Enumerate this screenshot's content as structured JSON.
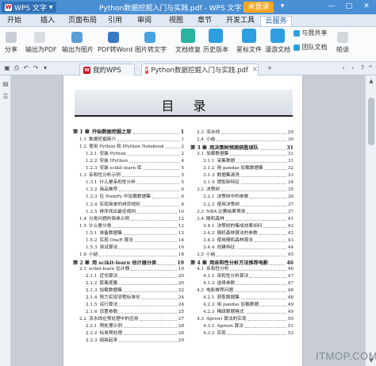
{
  "titlebar": {
    "app_name": "WPS 文字",
    "document_title": "Python数据挖掘入门与实践.pdf - WPS 文字",
    "login": "未登录",
    "minimize": "—",
    "maximize": "□",
    "close": "✕",
    "accent": "#4a8fd3"
  },
  "menu": {
    "items": [
      "开始",
      "插入",
      "页面布局",
      "引用",
      "审阅",
      "视图",
      "章节",
      "开发工具",
      "云服务"
    ],
    "active": "云服务"
  },
  "ribbon": {
    "buttons": [
      {
        "label": "分享",
        "icon": "share-icon"
      },
      {
        "label": "输出为PDF",
        "icon": "pdf-icon"
      },
      {
        "label": "输出为图片",
        "icon": "image-icon"
      },
      {
        "label": "PDF转Word",
        "icon": "pdf-word-icon"
      },
      {
        "label": "图片转文字",
        "icon": "ocr-icon"
      },
      {
        "label": "文档修复",
        "icon": "repair-icon"
      },
      {
        "label": "历史版本",
        "icon": "history-icon"
      },
      {
        "label": "星标文件",
        "icon": "star-file-icon"
      },
      {
        "label": "漫游文档",
        "icon": "roam-doc-icon"
      },
      {
        "label": "与我共享",
        "icon": "share-with-me-icon"
      },
      {
        "label": "团队文档",
        "icon": "team-doc-icon"
      },
      {
        "label": "帕谈",
        "icon": "chat-icon"
      }
    ]
  },
  "tabs": [
    {
      "label": "我的WPS",
      "active": false
    },
    {
      "label": "Python数据挖掘入门与实践.pdf",
      "active": true
    }
  ],
  "page": {
    "heading": "目录",
    "left_column": [
      {
        "num": "第 1 章",
        "text": "开始数据挖掘之旅",
        "page": "1",
        "level": 0
      },
      {
        "num": "1.1",
        "text": "数据挖掘简介",
        "page": "1",
        "level": 1
      },
      {
        "num": "1.2",
        "text": "使用 Python 和 IPython Notebook",
        "page": "2",
        "level": 1
      },
      {
        "num": "1.2.1",
        "text": "安装 Python",
        "page": "2",
        "level": 2
      },
      {
        "num": "1.2.2",
        "text": "安装 IPython",
        "page": "4",
        "level": 2
      },
      {
        "num": "1.2.3",
        "text": "安装 scikit-learn 库",
        "page": "5",
        "level": 2
      },
      {
        "num": "1.3",
        "text": "亲和性分析示例",
        "page": "5",
        "level": 1
      },
      {
        "num": "1.3.1",
        "text": "什么是亲和性分析",
        "page": "5",
        "level": 2
      },
      {
        "num": "1.3.2",
        "text": "商品推荐",
        "page": "6",
        "level": 2
      },
      {
        "num": "1.3.3",
        "text": "在 NumPy 中加载数据集",
        "page": "6",
        "level": 2
      },
      {
        "num": "1.3.4",
        "text": "实现简单的排序规则",
        "page": "8",
        "level": 2
      },
      {
        "num": "1.3.5",
        "text": "排序找出最佳规则",
        "page": "10",
        "level": 2
      },
      {
        "num": "1.4",
        "text": "分类问题的简单示例",
        "page": "12",
        "level": 1
      },
      {
        "num": "1.5",
        "text": "什么是分类",
        "page": "12",
        "level": 1
      },
      {
        "num": "1.5.1",
        "text": "准备数据集",
        "page": "13",
        "level": 2
      },
      {
        "num": "1.5.2",
        "text": "实现 OneR 算法",
        "page": "14",
        "level": 2
      },
      {
        "num": "1.5.3",
        "text": "测试算法",
        "page": "16",
        "level": 2
      },
      {
        "num": "1.6",
        "text": "小结",
        "page": "18",
        "level": 1
      },
      {
        "num": "第 2 章",
        "text": "用 scikit-learn 估计器分类",
        "page": "19",
        "level": 0
      },
      {
        "num": "2.1",
        "text": "scikit-learn 估计器",
        "page": "19",
        "level": 1
      },
      {
        "num": "2.1.1",
        "text": "近邻算法",
        "page": "20",
        "level": 2
      },
      {
        "num": "2.1.2",
        "text": "距离度量",
        "page": "20",
        "level": 2
      },
      {
        "num": "2.1.3",
        "text": "加载数据集",
        "page": "22",
        "level": 2
      },
      {
        "num": "2.1.4",
        "text": "努力实现流程标准化",
        "page": "24",
        "level": 2
      },
      {
        "num": "2.1.5",
        "text": "运行算法",
        "page": "24",
        "level": 2
      },
      {
        "num": "2.1.6",
        "text": "设置参数",
        "page": "25",
        "level": 2
      },
      {
        "num": "2.2",
        "text": "流水线在预处理中的应用",
        "page": "27",
        "level": 1
      },
      {
        "num": "2.2.1",
        "text": "预处理示例",
        "page": "28",
        "level": 2
      },
      {
        "num": "2.2.2",
        "text": "标准预处理",
        "page": "28",
        "level": 2
      },
      {
        "num": "2.2.3",
        "text": "组装起来",
        "page": "29",
        "level": 2
      }
    ],
    "right_column": [
      {
        "num": "2.3",
        "text": "流水线",
        "page": "29",
        "level": 1
      },
      {
        "num": "2.4",
        "text": "小结",
        "page": "30",
        "level": 1
      },
      {
        "num": "第 3 章",
        "text": "用决策树预测获胜球队",
        "page": "31",
        "level": 0
      },
      {
        "num": "3.1",
        "text": "加载数据集",
        "page": "31",
        "level": 1
      },
      {
        "num": "3.1.1",
        "text": "采集数据",
        "page": "31",
        "level": 2
      },
      {
        "num": "3.1.2",
        "text": "用 pandas 加载数据集",
        "page": "32",
        "level": 2
      },
      {
        "num": "3.1.3",
        "text": "数据集清洗",
        "page": "33",
        "level": 2
      },
      {
        "num": "3.1.4",
        "text": "提取新特征",
        "page": "34",
        "level": 2
      },
      {
        "num": "3.2",
        "text": "决策树",
        "page": "35",
        "level": 1
      },
      {
        "num": "3.2.1",
        "text": "决策树中的参数",
        "page": "36",
        "level": 2
      },
      {
        "num": "3.2.2",
        "text": "使用决策树",
        "page": "37",
        "level": 2
      },
      {
        "num": "3.3",
        "text": "NBA 比赛结果预测",
        "page": "37",
        "level": 1
      },
      {
        "num": "3.4",
        "text": "随机森林",
        "page": "41",
        "level": 1
      },
      {
        "num": "3.4.1",
        "text": "决策树的集成效果如何",
        "page": "42",
        "level": 2
      },
      {
        "num": "3.4.2",
        "text": "随机森林算法的参数",
        "page": "42",
        "level": 2
      },
      {
        "num": "3.4.3",
        "text": "使用随机森林算法",
        "page": "43",
        "level": 2
      },
      {
        "num": "3.4.4",
        "text": "创建特征",
        "page": "44",
        "level": 2
      },
      {
        "num": "3.5",
        "text": "小结",
        "page": "45",
        "level": 1
      },
      {
        "num": "第 4 章",
        "text": "用亲和性分析方法推荐电影",
        "page": "46",
        "level": 0
      },
      {
        "num": "4.1",
        "text": "亲和性分析",
        "page": "46",
        "level": 1
      },
      {
        "num": "4.1.1",
        "text": "亲和性分析算法",
        "page": "47",
        "level": 2
      },
      {
        "num": "4.1.2",
        "text": "选择参数",
        "page": "47",
        "level": 2
      },
      {
        "num": "4.2",
        "text": "电影推荐问题",
        "page": "48",
        "level": 1
      },
      {
        "num": "4.2.1",
        "text": "获取数据集",
        "page": "48",
        "level": 2
      },
      {
        "num": "4.2.2",
        "text": "用 pandas 加载数据",
        "page": "49",
        "level": 2
      },
      {
        "num": "4.2.3",
        "text": "稀疏数据格式",
        "page": "49",
        "level": 2
      },
      {
        "num": "4.3",
        "text": "Apriori 算法的实现",
        "page": "50",
        "level": 1
      },
      {
        "num": "4.3.1",
        "text": "Apriori 算法",
        "page": "51",
        "level": 2
      },
      {
        "num": "4.3.2",
        "text": "实现",
        "page": "52",
        "level": 2
      }
    ]
  },
  "watermark": "ITMOP.COM"
}
